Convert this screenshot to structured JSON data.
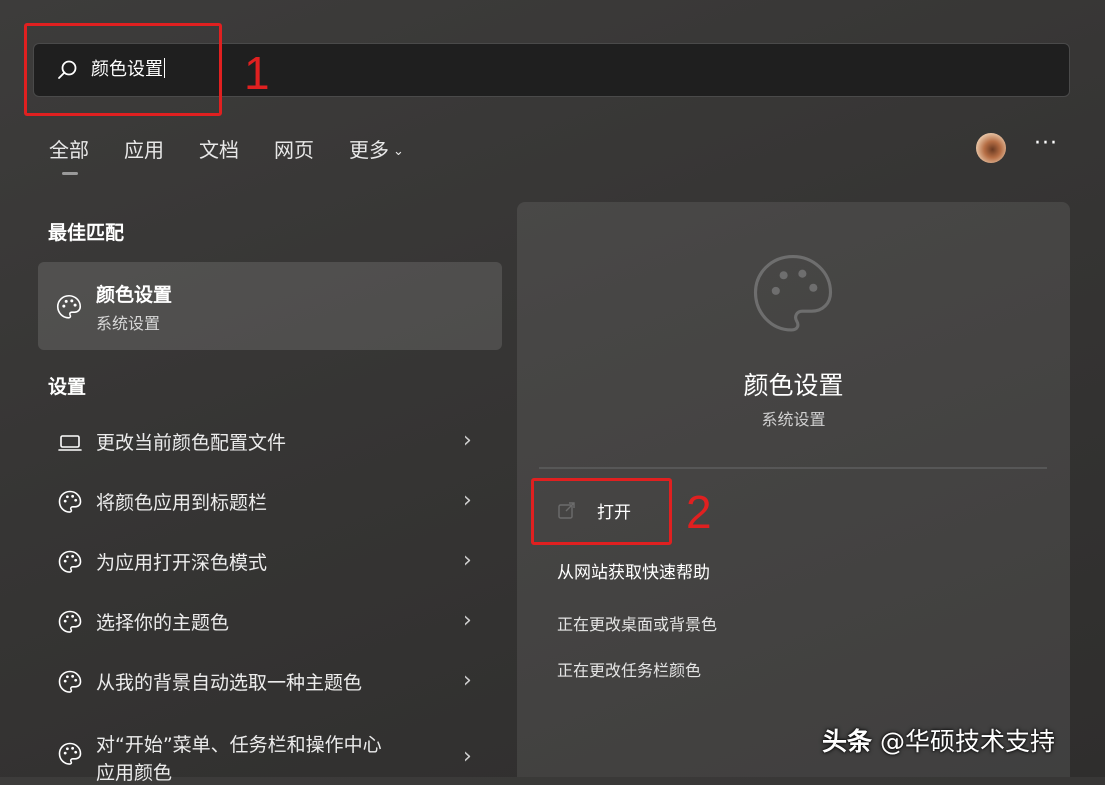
{
  "search": {
    "query": "颜色设置"
  },
  "tabs": [
    {
      "label": "全部",
      "active": true
    },
    {
      "label": "应用"
    },
    {
      "label": "文档"
    },
    {
      "label": "网页"
    },
    {
      "label": "更多"
    }
  ],
  "more_icon": "···",
  "best_match": {
    "section_title": "最佳匹配",
    "title": "颜色设置",
    "subtitle": "系统设置",
    "icon": "palette-icon"
  },
  "settings": {
    "section_title": "设置",
    "items": [
      {
        "label": "更改当前颜色配置文件",
        "icon": "laptop-icon"
      },
      {
        "label": "将颜色应用到标题栏",
        "icon": "palette-icon"
      },
      {
        "label": "为应用打开深色模式",
        "icon": "palette-icon"
      },
      {
        "label": "选择你的主题色",
        "icon": "palette-icon"
      },
      {
        "label": "从我的背景自动选取一种主题色",
        "icon": "palette-icon"
      },
      {
        "label": "对“开始”菜单、任务栏和操作中心",
        "label2": "应用颜色",
        "icon": "palette-icon"
      }
    ]
  },
  "detail": {
    "title": "颜色设置",
    "subtitle": "系统设置",
    "open_label": "打开",
    "help_label": "从网站获取快速帮助",
    "links": [
      "正在更改桌面或背景色",
      "正在更改任务栏颜色"
    ]
  },
  "annotations": [
    "1",
    "2"
  ],
  "watermark": {
    "brand": "头条",
    "handle": "@华硕技术支持"
  },
  "colors": {
    "annotation_red": "#e02020",
    "panel_bg": "#2f2e2d"
  }
}
